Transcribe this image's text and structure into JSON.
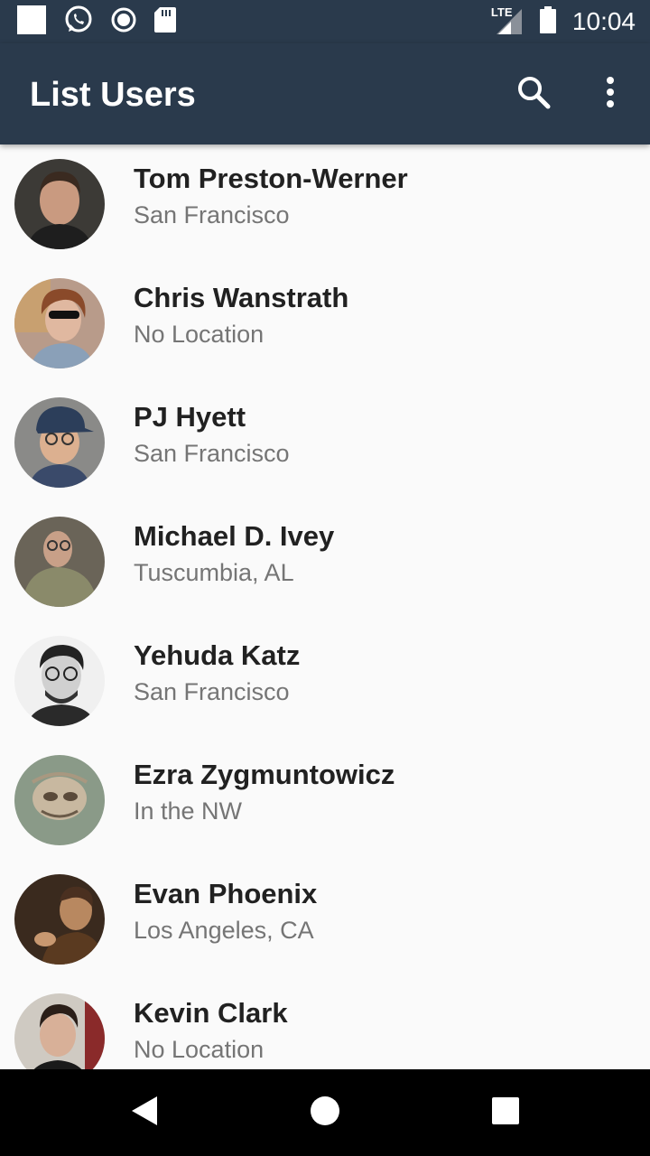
{
  "status_bar": {
    "time": "10:04",
    "network": "LTE",
    "left_icons": [
      "notification-square-icon",
      "whatsapp-icon",
      "record-icon",
      "sd-card-icon"
    ],
    "right_icons": [
      "lte-signal-icon",
      "battery-icon"
    ]
  },
  "app_bar": {
    "title": "List Users",
    "actions": [
      "search-icon",
      "more-vert-icon"
    ],
    "background": "#2a3a4c"
  },
  "users": [
    {
      "name": "Tom Preston-Werner",
      "location": "San Francisco"
    },
    {
      "name": "Chris Wanstrath",
      "location": "No Location"
    },
    {
      "name": "PJ Hyett",
      "location": "San Francisco"
    },
    {
      "name": "Michael D. Ivey",
      "location": "Tuscumbia, AL"
    },
    {
      "name": "Yehuda Katz",
      "location": "San Francisco"
    },
    {
      "name": "Ezra Zygmuntowicz",
      "location": "In the NW"
    },
    {
      "name": "Evan Phoenix",
      "location": "Los Angeles, CA"
    },
    {
      "name": "Kevin Clark",
      "location": "No Location"
    }
  ],
  "nav_bar": {
    "buttons": [
      "back-icon",
      "home-icon",
      "recents-icon"
    ]
  }
}
